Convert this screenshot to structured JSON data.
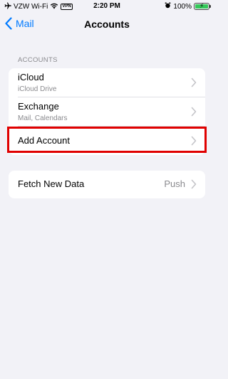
{
  "status_bar": {
    "carrier": "VZW Wi-Fi",
    "vpn": "VPN",
    "time": "2:20 PM",
    "battery": "100%",
    "icons": [
      "airplane-icon",
      "wifi-icon",
      "alarm-icon",
      "battery-icon"
    ]
  },
  "nav": {
    "back_label": "Mail",
    "title": "Accounts"
  },
  "accounts_section": {
    "header": "ACCOUNTS",
    "items": [
      {
        "title": "iCloud",
        "subtitle": "iCloud Drive"
      },
      {
        "title": "Exchange",
        "subtitle": "Mail, Calendars"
      },
      {
        "title": "Add Account"
      }
    ]
  },
  "fetch_section": {
    "title": "Fetch New Data",
    "value": "Push"
  },
  "colors": {
    "accent": "#007aff",
    "background": "#f2f2f7",
    "highlight": "#e00000",
    "battery": "#34c759"
  }
}
